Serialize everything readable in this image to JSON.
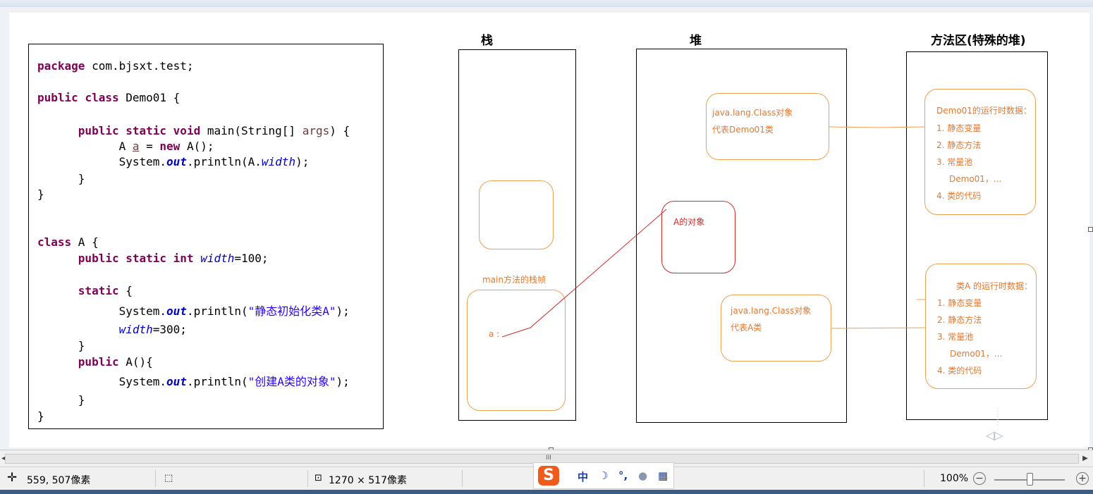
{
  "code": {
    "lines": [
      [
        {
          "t": "package",
          "c": "kw"
        },
        {
          "t": " com.bjsxt.test;"
        }
      ],
      [
        {
          "t": "public",
          "c": "kw"
        },
        {
          "t": " "
        },
        {
          "t": "class",
          "c": "kw"
        },
        {
          "t": " Demo01 {"
        }
      ],
      [
        {
          "t": "      "
        },
        {
          "t": "public",
          "c": "kw"
        },
        {
          "t": " "
        },
        {
          "t": "static",
          "c": "kw"
        },
        {
          "t": " "
        },
        {
          "t": "void",
          "c": "kw"
        },
        {
          "t": " main(String[] "
        },
        {
          "t": "args",
          "c": "param"
        },
        {
          "t": ") {"
        }
      ],
      [
        {
          "t": "            A "
        },
        {
          "t": "a",
          "c": "param ul"
        },
        {
          "t": " = "
        },
        {
          "t": "new",
          "c": "kw"
        },
        {
          "t": " A();"
        }
      ],
      [
        {
          "t": "            System."
        },
        {
          "t": "out",
          "c": "sfld"
        },
        {
          "t": ".println(A."
        },
        {
          "t": "width",
          "c": "fld"
        },
        {
          "t": ");"
        }
      ],
      [
        {
          "t": "      }"
        }
      ],
      [
        {
          "t": "}"
        }
      ],
      [
        {
          "t": "class",
          "c": "kw"
        },
        {
          "t": " A {"
        }
      ],
      [
        {
          "t": "      "
        },
        {
          "t": "public",
          "c": "kw"
        },
        {
          "t": " "
        },
        {
          "t": "static",
          "c": "kw"
        },
        {
          "t": " "
        },
        {
          "t": "int",
          "c": "kw"
        },
        {
          "t": " "
        },
        {
          "t": "width",
          "c": "fld"
        },
        {
          "t": "=100;"
        }
      ],
      [
        {
          "t": "      "
        },
        {
          "t": "static",
          "c": "kw"
        },
        {
          "t": " {"
        }
      ],
      [
        {
          "t": "            System."
        },
        {
          "t": "out",
          "c": "sfld"
        },
        {
          "t": ".println("
        },
        {
          "t": "\"静态初始化类A\"",
          "c": "str"
        },
        {
          "t": ");"
        }
      ],
      [
        {
          "t": "            "
        },
        {
          "t": "width",
          "c": "fld"
        },
        {
          "t": "=300;"
        }
      ],
      [
        {
          "t": "      }"
        }
      ],
      [
        {
          "t": "      "
        },
        {
          "t": "public",
          "c": "kw"
        },
        {
          "t": " A(){"
        }
      ],
      [
        {
          "t": "            System."
        },
        {
          "t": "out",
          "c": "sfld"
        },
        {
          "t": ".println("
        },
        {
          "t": "\"创建A类的对象\"",
          "c": "str"
        },
        {
          "t": ");"
        }
      ],
      [
        {
          "t": "      }"
        }
      ],
      [
        {
          "t": "}"
        }
      ]
    ]
  },
  "diagram": {
    "stack_title": "栈",
    "heap_title": "堆",
    "method_area_title": "方法区(特殊的堆)",
    "main_frame_label": "main方法的栈帧",
    "var_a_label": "a :",
    "class_obj_demo": [
      "java.lang.Class对象",
      "代表Demo01类"
    ],
    "a_object_label": "A的对象",
    "class_obj_a": [
      "java.lang.Class对象",
      "代表A类"
    ],
    "demo01_runtime": [
      "Demo01的运行时数据：",
      "1. 静态变量",
      "2. 静态方法",
      "3. 常量池",
      "Demo01，...",
      "4. 类的代码"
    ],
    "classA_runtime": [
      "类A 的运行时数据：",
      "1. 静态变量",
      "2. 静态方法",
      "3. 常量池",
      "Demo01，...",
      "4. 类的代码"
    ]
  },
  "statusbar": {
    "cursor_pos": "559, 507像素",
    "image_size": "1270 × 517像素",
    "zoom": "100%",
    "zoom_minus": "−",
    "zoom_plus": "+"
  },
  "ime": {
    "logo": "S",
    "mode": "中",
    "icons": [
      "moon-icon",
      "punctuation-icon",
      "user-icon",
      "grid-icon"
    ]
  },
  "colors": {
    "keyword": "#7f0055",
    "field": "#0000c0",
    "string": "#2a00ff",
    "orange": "#e8772e",
    "red": "#d42a2a"
  }
}
